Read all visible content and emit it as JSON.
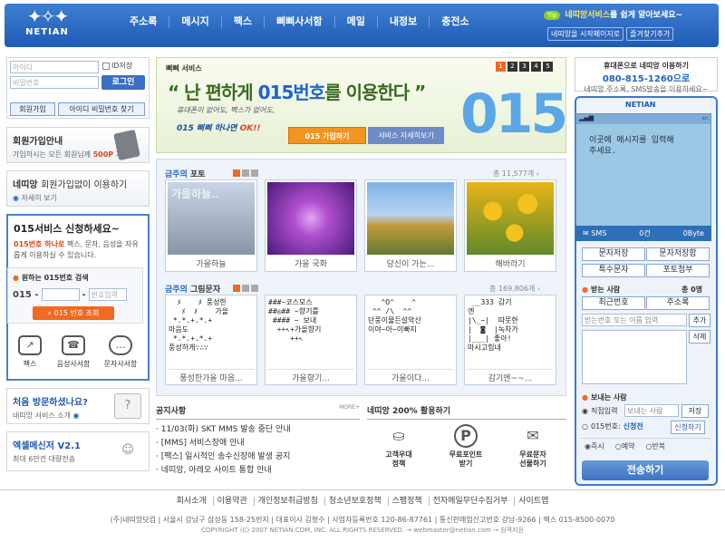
{
  "header": {
    "logo_text": "NETIAN",
    "nav": [
      "주소록",
      "메시지",
      "팩스",
      "삐삐사서함",
      "메일",
      "내정보",
      "충전소"
    ],
    "tip_badge": "Tip",
    "tip_text_highlight": "네띠앙서비스",
    "tip_text_rest": "를 쉽게 알아보세요~",
    "start_page_btn": "네띠앙을 시작페이지로",
    "favorite_btn": "즐겨찾기추가"
  },
  "login": {
    "id_placeholder": "아이디",
    "pw_placeholder": "비밀번호",
    "save_id": "ID저장",
    "login_btn": "로그인",
    "join_btn": "회원가입",
    "find_btn": "아이디 비밀번호 찾기"
  },
  "join_box": {
    "title": "회원가입안내",
    "text": "가입하시는 모든 회원님께",
    "highlight": "500P 지급"
  },
  "find_box": {
    "title_brand": "네띠앙",
    "title_rest": "회원가입없이 이용하기",
    "sub": "자세히 보기"
  },
  "o15": {
    "title": "015서비스 신청하세요~",
    "desc_highlight": "015번호 하나로",
    "desc": "팩스, 문자, 음성을 자유롭게 이용하실 수 있습니다.",
    "search_title": "원하는 015번호 검색",
    "prefix": "015 -",
    "dash": "-",
    "num_placeholder": "번호입력",
    "search_btn": "015 번호 조회",
    "icons": [
      {
        "label": "팩스",
        "icon": "fax-icon",
        "glyph": "↗"
      },
      {
        "label": "음성사서함",
        "icon": "voicemail-icon",
        "glyph": "☎"
      },
      {
        "label": "문자사서함",
        "icon": "sms-icon",
        "glyph": "…"
      }
    ]
  },
  "visit_box": {
    "title": "처음 방문하셨나요?",
    "sub": "네띠앙 서비스 소개",
    "icon_glyph": "?"
  },
  "ex_box": {
    "title": "엑셀메신저 V2.1",
    "sub": "최대 6만건 대량전송",
    "icon_glyph": "☺"
  },
  "banner": {
    "label": "삐삐 서비스",
    "headline_pre": "“ 난 편하게 ",
    "headline_mid": "015번호",
    "headline_post": "를 이용한다 ”",
    "sub1": "휴대폰이 없어도, 팩스가 없어도,",
    "sub2_pre": "015 삐삐 하나면 ",
    "sub2_ok": "OK!!",
    "big": "015",
    "pages": [
      "1",
      "2",
      "3",
      "4",
      "5"
    ],
    "join_btn": "015 가입하기",
    "detail_btn": "서비스 자세히보기"
  },
  "photos": {
    "title_hl": "금주의",
    "title": "포토",
    "count": "총 11,577개 ›",
    "items": [
      {
        "caption": "가을하늘",
        "overlay": "가을하늘..",
        "color1": "#c9d4e6",
        "color2": "#8a94a8"
      },
      {
        "caption": "가을 국화",
        "overlay": "",
        "color1": "#b04fd0",
        "color2": "#4a1a78"
      },
      {
        "caption": "당신이 가는...",
        "overlay": "",
        "color1": "#7fb2e6",
        "color2": "#5f7a35"
      },
      {
        "caption": "해바라기",
        "overlay": "",
        "color1": "#f4c21f",
        "color2": "#5f8a2a"
      }
    ]
  },
  "arts": {
    "title_hl": "금주의",
    "title": "그림문자",
    "count": "총 169,806개 ›",
    "items": [
      {
        "caption": "풍성한가을 마음...",
        "text": "  ﾒ    ﾒ 풍성한\n   ﾒ  ﾒ    가을\n *.*.+.*.+\n마음도\n *.*.+.*.+\n풍성하게∵∴∵"
      },
      {
        "caption": "가을향기...",
        "text": "###~코스모스\n##◎## ~향기를\n #### ~ 보내\n  ++↖+가을향기\n     ++↖"
      },
      {
        "caption": "가을이다...",
        "text": "   ^O^    ^\n ^^ /\\  ^^\n단풍이물든설악산\n이야~아~이빠지"
      },
      {
        "caption": "감기엔~~...",
        "text": " __333 감기\n엔\n|\\_~|  따뜻한\n|  ◙  |녹차가\n|___| 좋아!\n마시고힘내"
      }
    ]
  },
  "notice": {
    "title": "공지사항",
    "more": "MORE+",
    "items": [
      "· 11/03(화) SKT MMS 발송 중단 안내",
      "· [MMS] 서비스장애 안내",
      "· [팩스] 일시적인 송수신장애 발생 공지",
      "· 네띠앙, 아레오 사이트 통합 안내"
    ]
  },
  "use200": {
    "title": "네띠앙 200% 활용하기",
    "items": [
      {
        "label1": "고객우대",
        "label2": "정책",
        "icon": "money-bag-icon",
        "glyph": "⛀"
      },
      {
        "label1": "무료포인트",
        "label2": "받기",
        "icon": "point-icon",
        "glyph": "P"
      },
      {
        "label1": "무료문자",
        "label2": "선물하기",
        "icon": "gift-icon",
        "glyph": "✉"
      }
    ]
  },
  "right_top": {
    "line1": "휴대폰으로 네띠앙 이용하기",
    "line2": "080-815-1260으로",
    "line3": "네띠앙 주소록, SMS발송을 이용하세요~"
  },
  "phone": {
    "brand": "NETIAN",
    "message": "이곳에 메시지를 입력해 주세요.",
    "sms_label": "SMS",
    "count": "0건",
    "bytes": "0Byte",
    "btn_save": "문자저장",
    "btn_box": "문자저장함",
    "btn_special": "특수문자",
    "btn_photo": "포토첨부",
    "recv_title": "받는 사람",
    "recv_total": "총 0명",
    "recent": "최근번호",
    "addrbook": "주소록",
    "recv_placeholder": "받는번호 또는 이름 입력",
    "add": "추가",
    "delete": "삭제",
    "send_title": "보내는 사람",
    "direct": "직접입력",
    "sender_placeholder": "보내는 사람",
    "save": "저장",
    "o15_label": "015번호:",
    "o15_apply": "신청전",
    "apply_btn": "신청하기",
    "now": "즉시",
    "reserve": "예약",
    "repeat": "반복",
    "send_btn": "전송하기"
  },
  "footer": {
    "links": [
      "회사소개",
      "이용약관",
      "개인정보취급방침",
      "청소년보호정책",
      "스팸정책",
      "전자메일무단수집거부",
      "사이트맵"
    ],
    "info": "(주)네띠앙닷컴  |  서울시 강남구 삼성동 158-25번지  |  대표이사 김형수  |  사업자등록번호 120-86-87761  |  통신판매업신고번호 강남-9266  |  팩스 015-8500-0070",
    "copy": "COPYRIGHT (C) 2007 NETIAN.COM, INC. ALL RIGHTS RESERVED.  → webmaster@netian.com → 원격지원"
  }
}
